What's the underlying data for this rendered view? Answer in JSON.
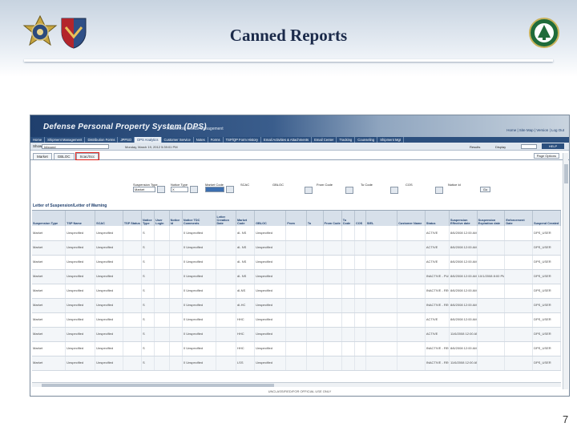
{
  "slide": {
    "title": "Canned Reports",
    "page_number": "7"
  },
  "app": {
    "title": "Defense Personal Property System (DPS)",
    "subtitle": "Household Goods Management",
    "top_links": "Home | Site Map | Version | Log Out"
  },
  "nav": {
    "items": [
      "Home",
      "Shipment Management",
      "Distribution Forms",
      "JPPSO",
      "DPS Analytics",
      "Customer Service",
      "Notes",
      "Forms",
      "TSP/QP Form History",
      "Email Activities & Attachments",
      "Email Center",
      "Tracking",
      "Counseling",
      "Shipment Mgt"
    ]
  },
  "show_bar": {
    "label": "Show",
    "select_value": "Inbound",
    "date_text": "Monday, March 19, 2012 5:39:01 PM",
    "results_label": "Results",
    "display_label": "Display",
    "help_label": "HELP"
  },
  "tabs": [
    "Market",
    "GBLOC",
    "Scac/Scc"
  ],
  "page_options": "Page Options",
  "filters": {
    "suspension_type": {
      "label": "Suspension Type",
      "value": "Market"
    },
    "notice_type": {
      "label": "Notice Type",
      "value": "X"
    },
    "market_code": {
      "label": "Market Code",
      "value": ""
    },
    "scac": {
      "label": "SCAC"
    },
    "gbloc": {
      "label": "GBLOC"
    },
    "from_code": {
      "label": "From Code"
    },
    "to_code": {
      "label": "To Code"
    },
    "cos": {
      "label": "COS"
    },
    "notice_id": {
      "label": "Notice Id"
    },
    "go": "Go"
  },
  "report": {
    "section_title": "Letter of Suspension/Letter of Warning",
    "columns": [
      "Suspension Type",
      "TSP Name",
      "SCAC",
      "TSP Status",
      "Notice Type",
      "User Login",
      "Notice Id",
      "Notice TDC Comments",
      "Letter Creation Date",
      "Market Code",
      "GBLOC",
      "From",
      "To",
      "From Code",
      "To Code",
      "COS",
      "SIEL",
      "Customer Name",
      "Status",
      "Suspension Effective date",
      "Suspension Expiration date",
      "Enforcement Date",
      "Suspend Created"
    ],
    "rows": [
      [
        "Market",
        "Unspecified",
        "Unspecified",
        "",
        "S",
        "",
        "",
        "0 Unspecified",
        "",
        "dI- NS",
        "Unspecified",
        "",
        "",
        "",
        "",
        "",
        "",
        "",
        "ACTIVE",
        "8/6/2008 12:00 AM",
        "",
        "",
        "DPS_USER"
      ],
      [
        "Market",
        "Unspecified",
        "Unspecified",
        "",
        "S",
        "",
        "",
        "0 Unspecified",
        "",
        "dI- NS",
        "Unspecified",
        "",
        "",
        "",
        "",
        "",
        "",
        "",
        "ACTIVE",
        "8/6/2008 12:00 AM",
        "",
        "",
        "DPS_USER"
      ],
      [
        "Market",
        "Unspecified",
        "Unspecified",
        "",
        "S",
        "",
        "",
        "0 Unspecified",
        "",
        "dI- NS",
        "Unspecified",
        "",
        "",
        "",
        "",
        "",
        "",
        "",
        "ACTIVE",
        "8/6/2008 12:00 AM",
        "",
        "",
        "DPS_USER"
      ],
      [
        "Market",
        "Unspecified",
        "Unspecified",
        "",
        "S",
        "",
        "",
        "0 Unspecified",
        "",
        "dI- NS",
        "Unspecified",
        "",
        "",
        "",
        "",
        "",
        "",
        "",
        "INACTIVE - PULLING",
        "8/6/2008 12:00 AM",
        "10/1/2008 8:00 PM",
        "",
        "DPS_USER"
      ],
      [
        "Market",
        "Unspecified",
        "Unspecified",
        "",
        "S",
        "",
        "",
        "0 Unspecified",
        "",
        "dI-NS",
        "Unspecified",
        "",
        "",
        "",
        "",
        "",
        "",
        "",
        "INACTIVE - REOFFER",
        "8/6/2008 12:00 AM",
        "",
        "",
        "DPS_USER"
      ],
      [
        "Market",
        "Unspecified",
        "Unspecified",
        "",
        "S",
        "",
        "",
        "0 Unspecified",
        "",
        "dI-HC",
        "Unspecified",
        "",
        "",
        "",
        "",
        "",
        "",
        "",
        "INACTIVE - REOFFER",
        "8/6/2008 12:00 AM",
        "",
        "",
        "DPS_USER"
      ],
      [
        "Market",
        "Unspecified",
        "Unspecified",
        "",
        "S",
        "",
        "",
        "0 Unspecified",
        "",
        "HHC",
        "Unspecified",
        "",
        "",
        "",
        "",
        "",
        "",
        "",
        "ACTIVE",
        "8/6/2008 12:00 AM",
        "",
        "",
        "DPS_USER"
      ],
      [
        "Market",
        "Unspecified",
        "Unspecified",
        "",
        "S",
        "",
        "",
        "0 Unspecified",
        "",
        "HHC",
        "Unspecified",
        "",
        "",
        "",
        "",
        "",
        "",
        "",
        "ACTIVE",
        "11/6/2008 12:00 AM",
        "",
        "",
        "DPS_USER"
      ],
      [
        "Market",
        "Unspecified",
        "Unspecified",
        "",
        "S",
        "",
        "",
        "0 Unspecified",
        "",
        "HHC",
        "Unspecified",
        "",
        "",
        "",
        "",
        "",
        "",
        "",
        "INACTIVE - REOFFER",
        "8/6/2008 12:00 AM",
        "",
        "",
        "DPS_USER"
      ],
      [
        "Market",
        "Unspecified",
        "Unspecified",
        "",
        "S",
        "",
        "",
        "0 Unspecified",
        "",
        "LSS",
        "Unspecified",
        "",
        "",
        "",
        "",
        "",
        "",
        "",
        "INACTIVE - REOFFER",
        "11/6/2008 12:00 AM",
        "",
        "",
        "DPS_USER"
      ]
    ]
  },
  "footer_note": "UNCLASSIFIED/FOR OFFICIAL USE ONLY",
  "colors": {
    "title": "#1b2a4a",
    "nav_bg": "#2b4f7e",
    "highlight": "#e0201a"
  }
}
